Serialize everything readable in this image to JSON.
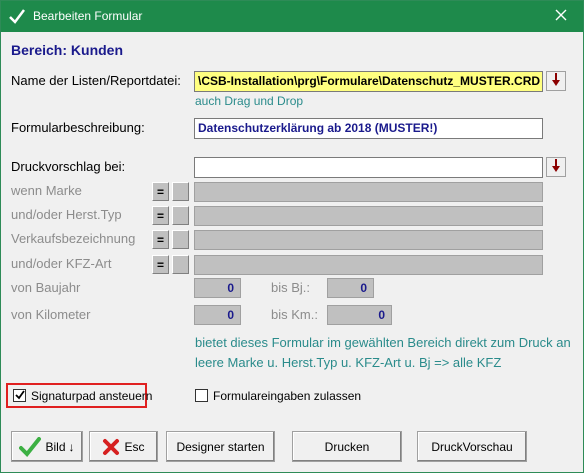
{
  "window": {
    "title": "Bearbeiten Formular",
    "close_icon": "close-icon",
    "app_icon": "checkmark-icon"
  },
  "section_title": "Bereich: Kunden",
  "file": {
    "label": "Name der Listen/Reportdatei:",
    "value": "\\CSB-Installation\\prg\\Formulare\\Datenschutz_MUSTER.CRD",
    "hint": "auch Drag und Drop",
    "dropdown_icon": "arrow-down-icon"
  },
  "description": {
    "label": "Formularbeschreibung:",
    "value": "Datenschutzerklärung ab 2018 (MUSTER!)"
  },
  "preview": {
    "label": "Druckvorschlag bei:",
    "value": ""
  },
  "filters": [
    {
      "label": "wenn Marke",
      "op": "=",
      "value": ""
    },
    {
      "label": "und/oder Herst.Typ",
      "op": "=",
      "value": ""
    },
    {
      "label": "Verkaufsbezeichnung",
      "op": "=",
      "value": ""
    },
    {
      "label": "und/oder KFZ-Art",
      "op": "=",
      "value": ""
    }
  ],
  "year": {
    "from_label": "von Baujahr",
    "from_value": "0",
    "to_label": "bis Bj.:",
    "to_value": "0"
  },
  "km": {
    "from_label": "von Kilometer",
    "from_value": "0",
    "to_label": "bis Km.:",
    "to_value": "0"
  },
  "info_text_1": "bietet dieses Formular im gewählten Bereich direkt zum Druck an",
  "info_text_2": "leere Marke u. Herst.Typ u. KFZ-Art u. Bj => alle KFZ",
  "checkboxes": {
    "signature": {
      "label": "Signaturpad ansteuern",
      "checked": true
    },
    "form_input": {
      "label": "Formulareingaben zulassen",
      "checked": false
    }
  },
  "buttons": {
    "bild": "Bild",
    "esc": "Esc",
    "designer": "Designer starten",
    "print": "Drucken",
    "preview": "DruckVorschau"
  },
  "colors": {
    "titlebar": "#1e8a4b",
    "heading": "#1a1a8c",
    "hint": "#2a8b8b",
    "highlight_field": "#ffff80",
    "annotation_box": "#e02020"
  }
}
